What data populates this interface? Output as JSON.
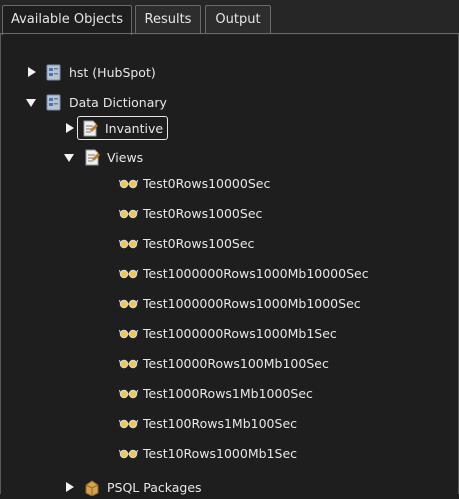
{
  "tabs": [
    {
      "label": "Available Objects"
    },
    {
      "label": "Results"
    },
    {
      "label": "Output"
    }
  ],
  "tree": {
    "hst": {
      "label": "hst (HubSpot)"
    },
    "data_dictionary": {
      "label": "Data Dictionary"
    },
    "invantive": {
      "label": "Invantive"
    },
    "views": {
      "label": "Views"
    },
    "view_items": [
      {
        "label": "Test0Rows10000Sec"
      },
      {
        "label": "Test0Rows1000Sec"
      },
      {
        "label": "Test0Rows100Sec"
      },
      {
        "label": "Test1000000Rows1000Mb10000Sec"
      },
      {
        "label": "Test1000000Rows1000Mb1000Sec"
      },
      {
        "label": "Test1000000Rows1000Mb1Sec"
      },
      {
        "label": "Test10000Rows100Mb100Sec"
      },
      {
        "label": "Test1000Rows1Mb1000Sec"
      },
      {
        "label": "Test100Rows1Mb100Sec"
      },
      {
        "label": "Test10Rows1000Mb1Sec"
      }
    ],
    "psql": {
      "label": "PSQL Packages"
    }
  },
  "colors": {
    "background": "#1e1e1e",
    "tab_border": "#6a6a6a",
    "text": "#e6e6e6"
  }
}
